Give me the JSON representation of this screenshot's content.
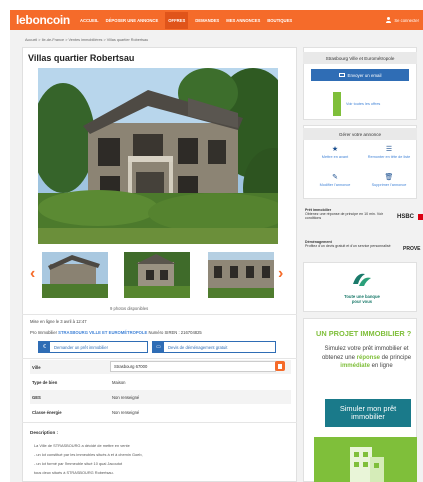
{
  "header": {
    "logo": "leboncoin",
    "nav": [
      "ACCUEIL",
      "DÉPOSER UNE ANNONCE",
      "OFFRES",
      "DEMANDES",
      "MES ANNONCES",
      "BOUTIQUES"
    ],
    "active_nav": "OFFRES",
    "user_label": "Se connecter"
  },
  "breadcrumb": "Accueil > Ile-de-France > Ventes immobilières > Villas quartier Robertsau",
  "listing": {
    "title": "Villas quartier Robertsau",
    "photo_count_label": "9 photos disponibles",
    "posted": "Mise en ligne le 3 avril à 12:47",
    "pro_prefix": "Pro Immobilier",
    "pro_name": "STRASBOURG VILLE ET EUROMÉTROPOLE",
    "siren": "Numéro SIREN : 216704825",
    "btn_loan": "Demander un prêt immobilier",
    "btn_move": "Devis de déménagement gratuit",
    "attributes": [
      {
        "key": "Ville",
        "value": "Strasbourg 67000"
      },
      {
        "key": "Type de bien",
        "value": "Maison"
      },
      {
        "key": "GES",
        "value": "Non renseigné"
      },
      {
        "key": "Classe énergie",
        "value": "Non renseigné"
      }
    ],
    "description_heading": "Description :",
    "description_lines": [
      "La Ville de STRASBOURG a décidé de mettre en vente",
      "- un lot constitué par les immeubles situés à et à chemin Goeb,",
      "- un lot formé par l'immeuble situé 10 quai Jacoutot",
      "tous deux situés à STRASBOURG Robertsau."
    ]
  },
  "sidebar": {
    "seller_name": "Strasbourg Ville et Eurométropole",
    "email_button": "Envoyer un email",
    "all_offers": "Voir toutes les offres",
    "manage_heading": "Gérer votre annonce",
    "actions": [
      {
        "icon": "star-icon",
        "glyph": "★",
        "label": "Mettre en avant"
      },
      {
        "icon": "list-up-icon",
        "glyph": "☰",
        "label": "Remonter en tête de liste"
      },
      {
        "icon": "pencil-icon",
        "glyph": "✎",
        "label": "Modifier l'annonce"
      },
      {
        "icon": "trash-icon",
        "glyph": "🗑",
        "label": "Supprimer l'annonce"
      }
    ],
    "ads": [
      {
        "title": "Prêt immobilier",
        "text": "Obtenez une réponse de principe en 10 min. Voir conditions",
        "brand": "HSBC"
      },
      {
        "title": "Déménagement",
        "text": "Profitez d'un devis gratuit et d'un service personnalisé",
        "brand": "PROVE"
      }
    ],
    "ca_tagline": "Toute une banque pour vous",
    "promo_title": "UN PROJET IMMOBILIER ?",
    "promo_text_1": "Simulez votre prêt immobilier et obtenez une",
    "promo_text_hl1": "réponse",
    "promo_text_2": "de principe",
    "promo_text_hl2": "immédiate",
    "promo_text_3": "en ligne",
    "simulate_button": "Simuler mon prêt immobilier"
  },
  "colors": {
    "brand_orange": "#f56b2a",
    "link_blue": "#4183d7",
    "button_blue": "#2f6db5",
    "promo_green": "#7fbf3a",
    "promo_teal": "#1a7a8a"
  }
}
